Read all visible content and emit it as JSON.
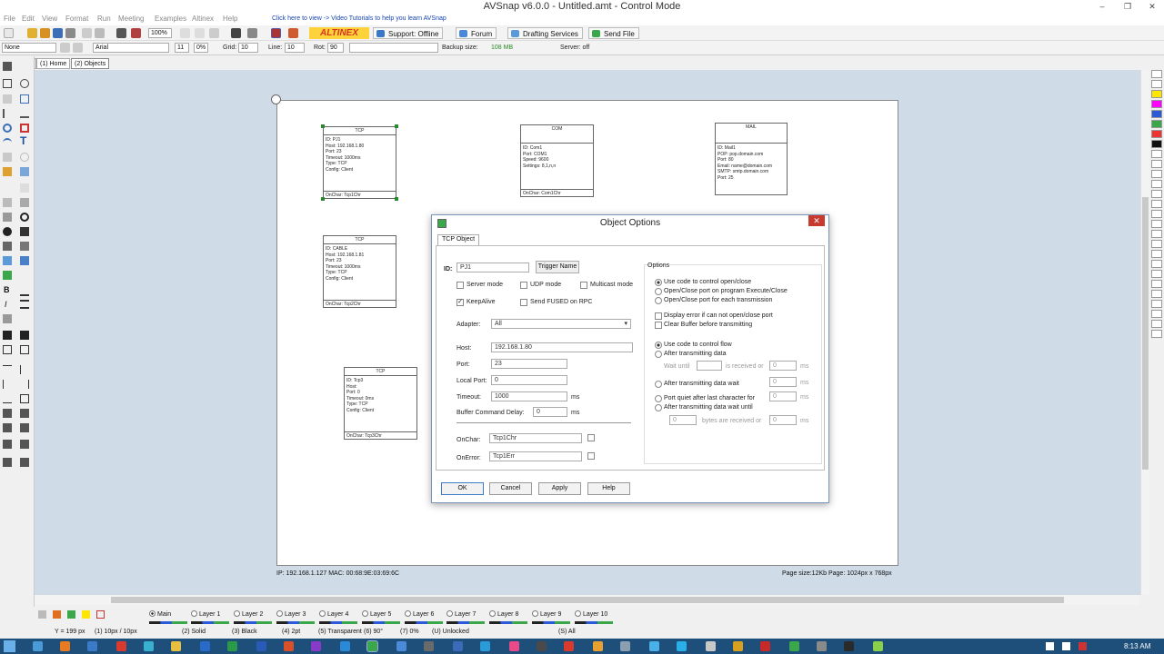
{
  "window": {
    "title": "AVSnap v6.0.0 - Untitled.amt - Control Mode",
    "controls": [
      "–",
      "❐",
      "✕"
    ]
  },
  "menu": {
    "items": [
      "File",
      "Edit",
      "View",
      "Format",
      "Run",
      "Meeting",
      "Examples",
      "Altinex",
      "Help"
    ],
    "promo": "Click here to view -> Video Tutorials to help you learn AVSnap"
  },
  "toolbar1": {
    "zoom": "100%",
    "brand": "ALTINEX",
    "support": "Support: Offline",
    "forum": "Forum",
    "drafting": "Drafting Services",
    "sendfile": "Send File"
  },
  "toolbar2": {
    "style": "None",
    "font": "Arial",
    "fontsize": "11",
    "pct": "0%",
    "grid_label": "Grid:",
    "grid": "10",
    "line_label": "Line:",
    "line": "10",
    "rot_label": "Rot:",
    "rot": "90",
    "backup_label": "Backup size:",
    "backup": "108 MB",
    "server": "Server: off"
  },
  "tabs": [
    "(1) Home",
    "(2) Objects"
  ],
  "objects": [
    {
      "header": "TCP",
      "body": "ID: PJ1\nHost: 192.168.1.80\nPort: 23\nTimeout: 1000ms\nType: TCP\nConfig: Client",
      "foot": "OnChar: Tcp1Chr"
    },
    {
      "header": "COM",
      "body": "ID: Com1\nPort: COM1\nSpeed: 9600\nSettings: 8,1,n,n",
      "foot": "OnChar: Com1Chr"
    },
    {
      "header": "MAIL",
      "body": "ID: Mail1\nPOP: pop.domain.com\nPort: 80\nEmail: name@domain.com\nSMTP: smtp.domain.com\nPort: 25",
      "foot": ""
    },
    {
      "header": "TCP",
      "body": "ID: CABLE\nHost: 192.168.1.81\nPort: 23\nTimeout: 1000ms\nType: TCP\nConfig: Client",
      "foot": "OnChar: Tcp2Chr"
    },
    {
      "header": "TCP",
      "body": "ID: Tcp3\nHost:\nPort: 0\nTimeout: 0ms\nType: TCP\nConfig: Client",
      "foot": "OnChar: Tcp3Chr"
    }
  ],
  "page_info": {
    "ip": "IP: 192.168.1.127    MAC: 00:68:9E:03:69:6C",
    "size": "Page size:12Kb    Page: 1024px x 768px"
  },
  "dialog": {
    "title": "Object Options",
    "tab": "TCP Object",
    "id_label": "ID:",
    "id_value": "PJ1",
    "trigger_button": "Trigger Name",
    "server_mode": "Server mode",
    "udp_mode": "UDP mode",
    "multicast_mode": "Multicast mode",
    "keepalive": "KeepAlive",
    "send_fused": "Send FUSED on RPC",
    "adapter_label": "Adapter:",
    "adapter_value": "All",
    "host_label": "Host:",
    "host_value": "192.168.1.80",
    "port_label": "Port:",
    "port_value": "23",
    "localport_label": "Local Port:",
    "localport_value": "0",
    "timeout_label": "Timeout:",
    "timeout_value": "1000",
    "ms": "ms",
    "bufdelay_label": "Buffer Command Delay:",
    "bufdelay_value": "0",
    "onchar_label": "OnChar:",
    "onchar_value": "Tcp1Chr",
    "onerror_label": "OnError:",
    "onerror_value": "Tcp1Err",
    "options_title": "Options",
    "opt1": "Use code to control open/close",
    "opt2": "Open/Close port on program Execute/Close",
    "opt3": "Open/Close port for each transmission",
    "opt4": "Display error if can not open/close port",
    "opt5": "Clear Buffer before transmitting",
    "flow1": "Use code to control flow",
    "flow2": "After transmitting data",
    "wait_until": "Wait until",
    "is_received_or": "is received or",
    "zero": "0",
    "flow3": "After transmitting data wait",
    "flow4": "Port quiet after last character for",
    "flow5": "After transmitting data wait until",
    "bytes_received": "bytes are received or",
    "ok": "OK",
    "cancel": "Cancel",
    "apply": "Apply",
    "help": "Help"
  },
  "layers": [
    "Main",
    "Layer 1",
    "Layer 2",
    "Layer 3",
    "Layer 4",
    "Layer 5",
    "Layer 6",
    "Layer 7",
    "Layer 8",
    "Layer 9",
    "Layer 10"
  ],
  "status": [
    "Y = 199 px",
    "(1) 10px / 10px",
    "(2) Solid",
    "(3) Black",
    "(4) 2pt",
    "(5) Transparent",
    "(6) 90°",
    "(7) 0%",
    "(U) Unlocked",
    "(S) All"
  ],
  "clock": "8:13 AM"
}
